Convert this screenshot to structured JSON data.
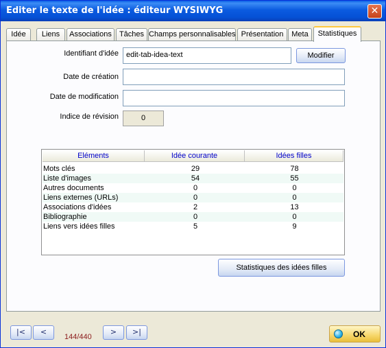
{
  "window": {
    "title": "Editer le texte de l'idée : éditeur WYSIWYG",
    "close_symbol": "✕"
  },
  "tabs": [
    "Idée",
    "Liens",
    "Associations",
    "Tâches",
    "Champs personnalisables",
    "Présentation",
    "Meta",
    "Statistiques"
  ],
  "active_tab": "Statistiques",
  "form": {
    "id_label": "Identifiant d'idée",
    "id_value": "edit-tab-idea-text",
    "modify_button": "Modifier",
    "created_label": "Date de création",
    "created_value": "",
    "modified_label": "Date de modification",
    "modified_value": "",
    "revision_label": "Indice de révision",
    "revision_value": "0"
  },
  "stats_table": {
    "headers": [
      "Eléments",
      "Idée courante",
      "Idées filles"
    ],
    "rows": [
      [
        "Mots clés",
        "29",
        "78"
      ],
      [
        "Liste d'images",
        "54",
        "55"
      ],
      [
        "Autres documents",
        "0",
        "0"
      ],
      [
        "Liens externes (URLs)",
        "0",
        "0"
      ],
      [
        "Associations d'idées",
        "2",
        "13"
      ],
      [
        "Bibliographie",
        "0",
        "0"
      ],
      [
        "Liens vers idées filles",
        "5",
        "9"
      ]
    ]
  },
  "child_stats_button": "Statistiques des idées filles",
  "navigation": {
    "first": "|<",
    "prev": "<",
    "counter": "144/440",
    "next": ">",
    "last": ">|"
  },
  "ok_button": "OK",
  "colors": {
    "title_bar": "#0A5FE6",
    "header_text": "#0000C8",
    "counter_text": "#8B1A1A",
    "row_alt": "#F0FAF6"
  }
}
